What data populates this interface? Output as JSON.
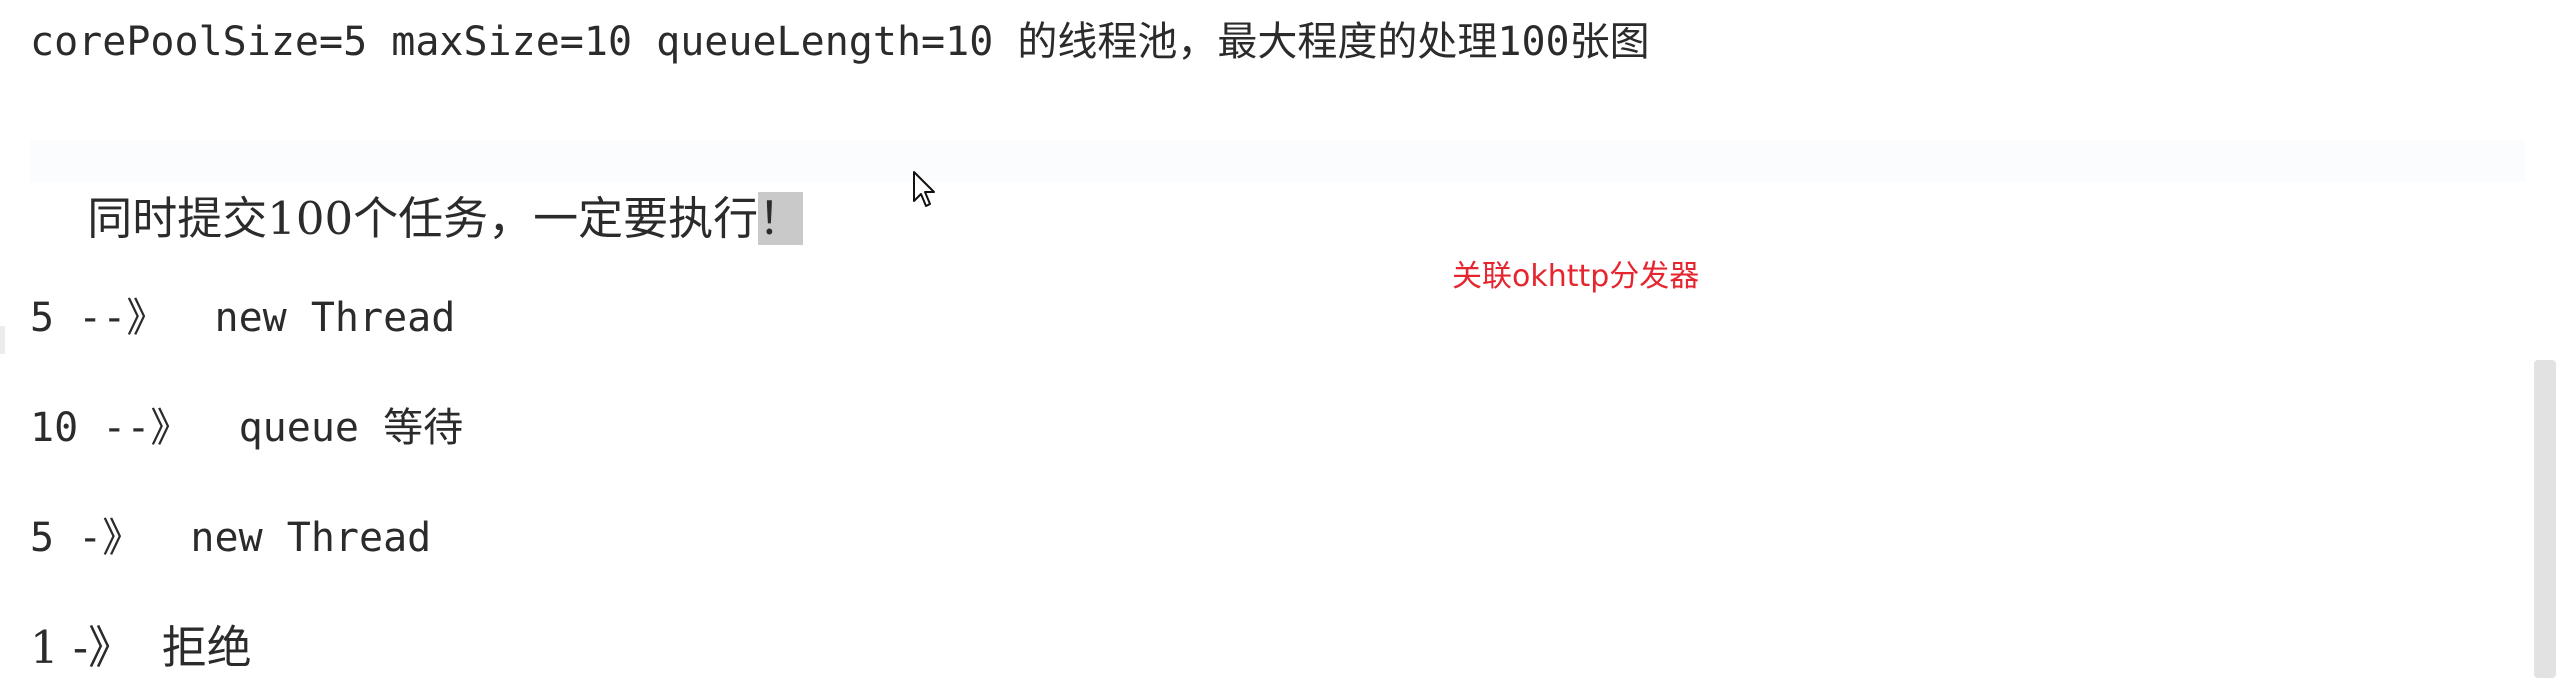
{
  "document": {
    "lines": {
      "line1": "corePoolSize=5 maxSize=10 queueLength=10 的线程池，最大程度的处理100张图",
      "line2_main": "同时提交100个任务，一定要执行",
      "line2_selected": "！",
      "line3": "5 --》  new Thread",
      "line4": "10 --》  queue 等待",
      "line5": "5 -》  new Thread",
      "line6": "1 -》  拒绝"
    },
    "annotation": "关联okhttp分发器"
  },
  "colors": {
    "text": "#2b2b2b",
    "annotation": "#e5262f",
    "selection": "#c9c9c9",
    "scrollbar_thumb": "#e2e2e2"
  },
  "icons": {
    "cursor": "mouse-pointer-icon"
  }
}
